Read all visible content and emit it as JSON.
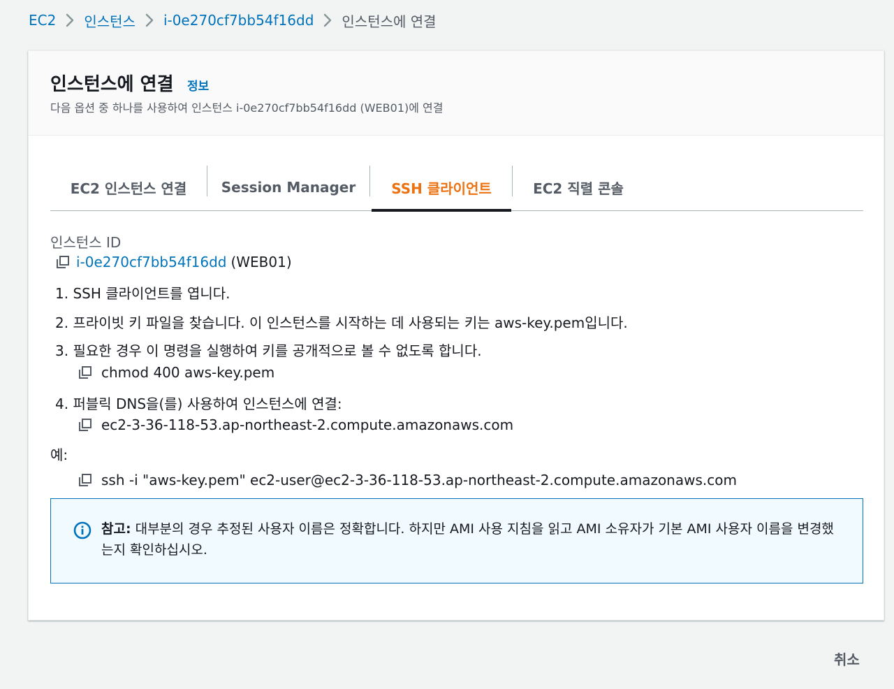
{
  "breadcrumb": {
    "items": [
      "EC2",
      "인스턴스",
      "i-0e270cf7bb54f16dd"
    ],
    "current": "인스턴스에 연결"
  },
  "header": {
    "title": "인스턴스에 연결",
    "info_link": "정보",
    "description": "다음 옵션 중 하나를 사용하여 인스턴스 i-0e270cf7bb54f16dd (WEB01)에 연결"
  },
  "tabs": [
    {
      "label": "EC2 인스턴스 연결",
      "active": false
    },
    {
      "label": "Session Manager",
      "active": false
    },
    {
      "label": "SSH 클라이언트",
      "active": true
    },
    {
      "label": "EC2 직렬 콘솔",
      "active": false
    }
  ],
  "instance": {
    "label": "인스턴스 ID",
    "id": "i-0e270cf7bb54f16dd",
    "name_suffix": "(WEB01)"
  },
  "steps": [
    "1. SSH 클라이언트를 엽니다.",
    "2. 프라이빗 키 파일을 찾습니다. 이 인스턴스를 시작하는 데 사용되는 키는 aws-key.pem입니다.",
    "3. 필요한 경우 이 명령을 실행하여 키를 공개적으로 볼 수 없도록 합니다.",
    "4. 퍼블릭 DNS을(를) 사용하여 인스턴스에 연결:"
  ],
  "commands": {
    "chmod": "chmod 400 aws-key.pem",
    "dns": "ec2-3-36-118-53.ap-northeast-2.compute.amazonaws.com",
    "ssh": "ssh -i \"aws-key.pem\" ec2-user@ec2-3-36-118-53.ap-northeast-2.compute.amazonaws.com"
  },
  "example_label": "예:",
  "alert": {
    "prefix": "참고:",
    "text": " 대부분의 경우 추정된 사용자 이름은 정확합니다. 하지만 AMI 사용 지침을 읽고 AMI 소유자가 기본 AMI 사용자 이름을 변경했는지 확인하십시오.",
    "icon": "info-icon"
  },
  "footer": {
    "cancel_label": "취소"
  },
  "colors": {
    "link": "#0073bb",
    "active_tab": "#ec7211",
    "text": "#16191f",
    "muted": "#545b64",
    "alert_bg": "#f1faff",
    "alert_border": "#0073bb"
  }
}
